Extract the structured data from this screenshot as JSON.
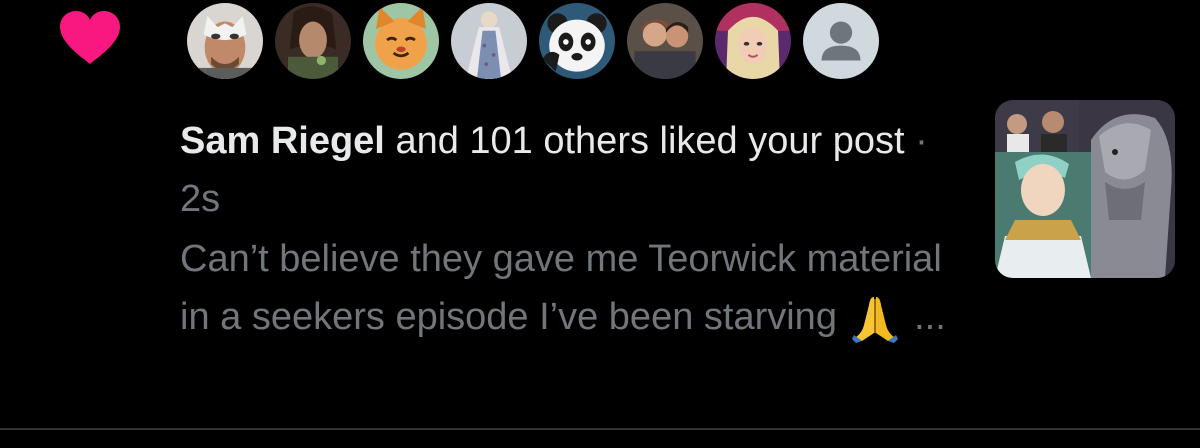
{
  "notification": {
    "type_icon": "heart-icon",
    "accent_color": "#f91880",
    "avatars": [
      {
        "icon": "avatar-masked-man"
      },
      {
        "icon": "avatar-elf-character"
      },
      {
        "icon": "avatar-orange-cat-art"
      },
      {
        "icon": "avatar-gown-figure"
      },
      {
        "icon": "avatar-panda"
      },
      {
        "icon": "avatar-group-photo"
      },
      {
        "icon": "avatar-blonde-woman"
      },
      {
        "icon": "avatar-default-placeholder"
      }
    ],
    "actor_name": "Sam Riegel",
    "action_text": "and 101 others liked your post",
    "separator": "·",
    "timestamp": "2s",
    "post_preview": "Can’t believe they gave me Teorwick material in a seekers episode I’ve been starving",
    "emoji_icon": "folded-hands-emoji",
    "ellipsis": "...",
    "media_thumbnail": "post-media-thumbnail"
  }
}
